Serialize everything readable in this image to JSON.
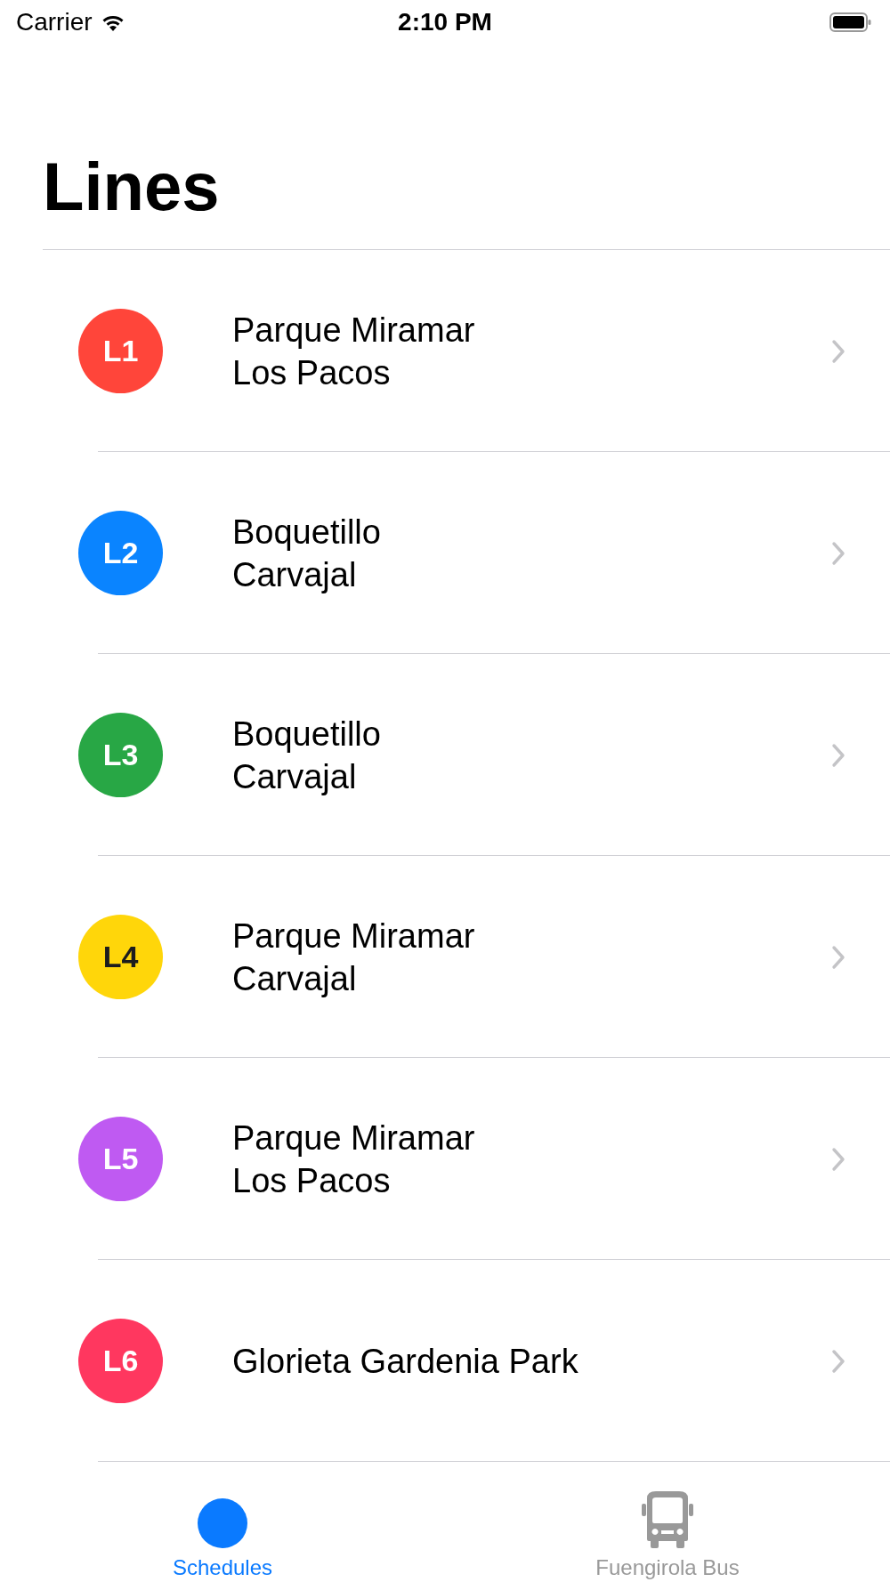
{
  "status_bar": {
    "carrier": "Carrier",
    "time": "2:10 PM"
  },
  "title": "Lines",
  "lines": [
    {
      "code": "L1",
      "color": "#ff453a",
      "stops": [
        "Parque Miramar",
        "Los Pacos"
      ]
    },
    {
      "code": "L2",
      "color": "#0a84ff",
      "stops": [
        "Boquetillo",
        "Carvajal"
      ]
    },
    {
      "code": "L3",
      "color": "#28a745",
      "stops": [
        "Boquetillo",
        "Carvajal"
      ]
    },
    {
      "code": "L4",
      "color": "#ffd60a",
      "stops": [
        "Parque Miramar",
        "Carvajal"
      ]
    },
    {
      "code": "L5",
      "color": "#bf5af2",
      "stops": [
        "Parque Miramar",
        "Los Pacos"
      ]
    },
    {
      "code": "L6",
      "color": "#ff375f",
      "stops": [
        "Glorieta Gardenia Park"
      ]
    }
  ],
  "tabs": [
    {
      "label": "Schedules",
      "kind": "dot",
      "selected": true
    },
    {
      "label": "Fuengirola Bus",
      "kind": "bus",
      "selected": false
    }
  ]
}
